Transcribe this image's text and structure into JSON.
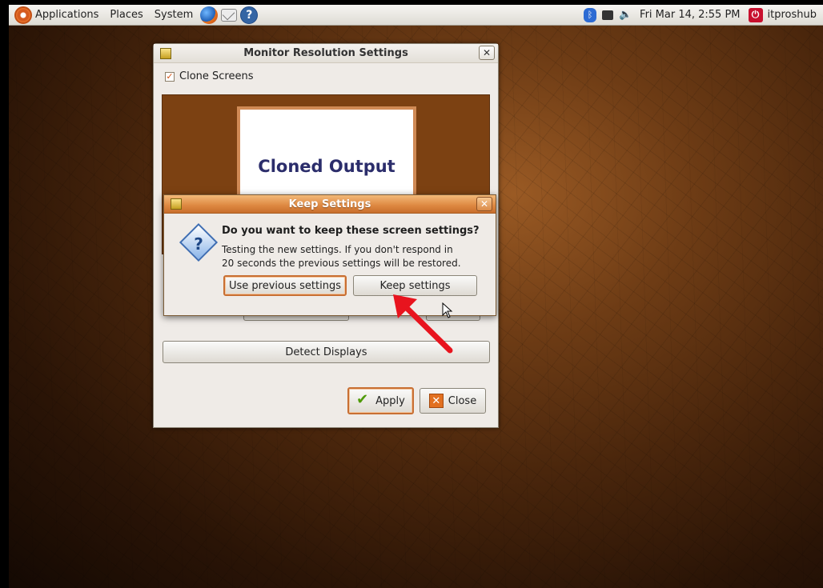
{
  "panel": {
    "menus": [
      "Applications",
      "Places",
      "System"
    ],
    "launchers": [
      "firefox-icon",
      "mail-icon",
      "help-icon"
    ],
    "tray_icons": [
      "bluetooth-icon",
      "network-icon",
      "volume-icon"
    ],
    "clock": "Fri Mar 14,  2:55 PM",
    "username": "itproshub"
  },
  "main_window": {
    "title": "Monitor Resolution Settings",
    "clone_screens_label": "Clone Screens",
    "clone_screens_checked": true,
    "preview_label": "Cloned Output",
    "detect_displays_label": "Detect Displays",
    "apply_label": "Apply",
    "close_label": "Close"
  },
  "dialog": {
    "title": "Keep Settings",
    "heading": "Do you want to keep these screen settings?",
    "body_line1": "Testing the new settings. If you don't respond in",
    "body_line2": "20 seconds the previous settings will be restored.",
    "use_previous_label": "Use previous settings",
    "keep_label": "Keep settings"
  },
  "colors": {
    "accent_orange": "#dd8740",
    "arrow_red": "#e8141e",
    "preview_brown": "#7c4112"
  }
}
